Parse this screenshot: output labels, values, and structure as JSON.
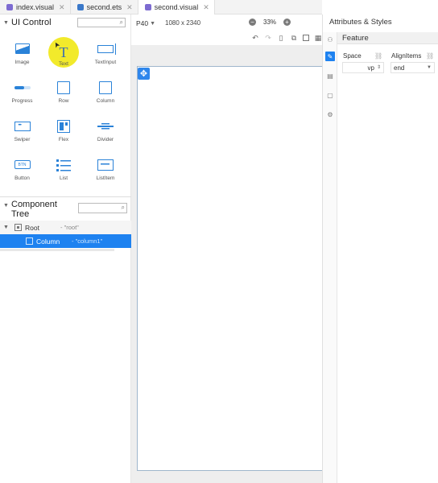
{
  "tabs": [
    {
      "label": "index.visual",
      "active": false,
      "kind": "visual"
    },
    {
      "label": "second.ets",
      "active": false,
      "kind": "ets"
    },
    {
      "label": "second.visual",
      "active": true,
      "kind": "visual"
    }
  ],
  "ui_control": {
    "title": "UI Control",
    "components": [
      {
        "label": "Image",
        "icon": "image-icon"
      },
      {
        "label": "Text",
        "icon": "text-icon",
        "glyph": "T"
      },
      {
        "label": "TextInput",
        "icon": "textinput-icon"
      },
      {
        "label": "Progress",
        "icon": "progress-icon"
      },
      {
        "label": "Row",
        "icon": "row-icon"
      },
      {
        "label": "Column",
        "icon": "column-icon"
      },
      {
        "label": "Swiper",
        "icon": "swiper-icon"
      },
      {
        "label": "Flex",
        "icon": "flex-icon"
      },
      {
        "label": "Divider",
        "icon": "divider-icon"
      },
      {
        "label": "Button",
        "icon": "button-icon",
        "glyph": "BTN"
      },
      {
        "label": "List",
        "icon": "list-icon"
      },
      {
        "label": "ListItem",
        "icon": "listitem-icon"
      }
    ]
  },
  "component_tree": {
    "title": "Component Tree",
    "nodes": [
      {
        "name": "Root",
        "id": "- \"root\""
      },
      {
        "name": "Column",
        "id": "- \"column1\"",
        "selected": true
      }
    ]
  },
  "toolbar": {
    "device": "P40",
    "resolution": "1080 x 2340",
    "zoom": "33%"
  },
  "right_panel": {
    "title": "Attributes & Styles",
    "section": "Feature",
    "space_label": "Space",
    "space_unit": "vp",
    "alignitems_label": "AlignItems",
    "alignitems_value": "end"
  },
  "colors": {
    "accent": "#1e82f0",
    "icon_blue": "#2a82d8",
    "highlight": "#f2ea2b"
  }
}
